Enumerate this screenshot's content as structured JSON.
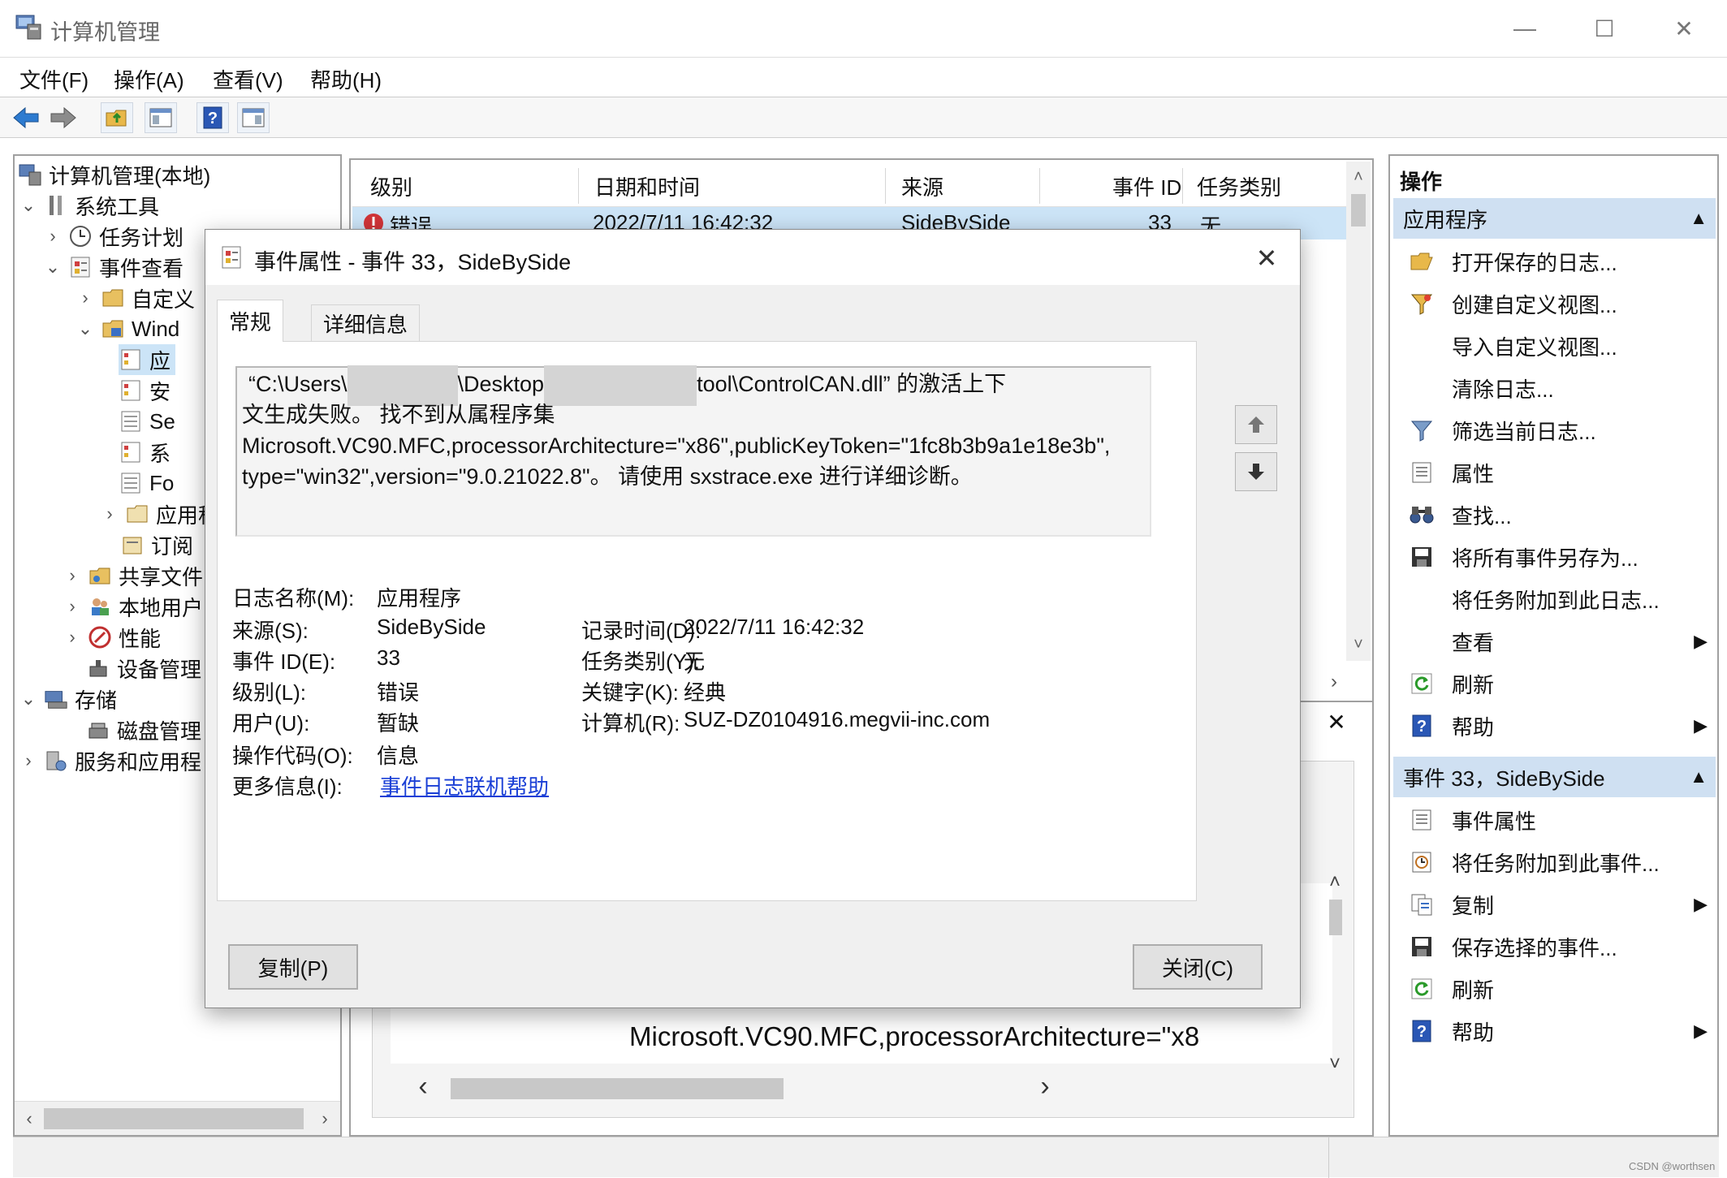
{
  "window": {
    "title": "计算机管理",
    "minimize_label": "—",
    "maximize_label": "☐",
    "close_label": "✕"
  },
  "menu": [
    "文件(F)",
    "操作(A)",
    "查看(V)",
    "帮助(H)"
  ],
  "tree": {
    "root": "计算机管理(本地)",
    "items": [
      {
        "label": "系统工具",
        "caret": "⌄"
      },
      {
        "label": "任务计划",
        "caret": "›"
      },
      {
        "label": "事件查看",
        "caret": "⌄"
      },
      {
        "label": "自定义",
        "caret": "›"
      },
      {
        "label": "Wind",
        "caret": "⌄"
      },
      {
        "label": "应",
        "caret": ""
      },
      {
        "label": "安",
        "caret": ""
      },
      {
        "label": "Se",
        "caret": ""
      },
      {
        "label": "系",
        "caret": ""
      },
      {
        "label": "Fo",
        "caret": ""
      },
      {
        "label": "应用程",
        "caret": "›"
      },
      {
        "label": "订阅",
        "caret": ""
      },
      {
        "label": "共享文件",
        "caret": "›"
      },
      {
        "label": "本地用户",
        "caret": "›"
      },
      {
        "label": "性能",
        "caret": "›"
      },
      {
        "label": "设备管理",
        "caret": ""
      },
      {
        "label": "存储",
        "caret": "⌄"
      },
      {
        "label": "磁盘管理",
        "caret": ""
      },
      {
        "label": "服务和应用程",
        "caret": "›"
      }
    ]
  },
  "event_table": {
    "columns": [
      "级别",
      "日期和时间",
      "来源",
      "事件 ID",
      "任务类别"
    ],
    "rows": [
      {
        "level": "错误",
        "datetime": "2022/7/11 16:42:32",
        "source": "SideBySide",
        "event_id": "33",
        "task": "无"
      }
    ]
  },
  "detail_preview_text": "Microsoft.VC90.MFC,processorArchitecture=\"x8",
  "actions": {
    "header": "操作",
    "groups": [
      {
        "title": "应用程序",
        "items": [
          {
            "label": "打开保存的日志...",
            "icon": "folder-open-icon",
            "submenu": false
          },
          {
            "label": "创建自定义视图...",
            "icon": "filter-icon",
            "submenu": false
          },
          {
            "label": "导入自定义视图...",
            "icon": "",
            "submenu": false
          },
          {
            "label": "清除日志...",
            "icon": "",
            "submenu": false
          },
          {
            "label": "筛选当前日志...",
            "icon": "filter-icon",
            "submenu": false
          },
          {
            "label": "属性",
            "icon": "properties-icon",
            "submenu": false
          },
          {
            "label": "查找...",
            "icon": "binoculars-icon",
            "submenu": false
          },
          {
            "label": "将所有事件另存为...",
            "icon": "save-icon",
            "submenu": false
          },
          {
            "label": "将任务附加到此日志...",
            "icon": "",
            "submenu": false
          },
          {
            "label": "查看",
            "icon": "",
            "submenu": true
          },
          {
            "label": "刷新",
            "icon": "refresh-icon",
            "submenu": false
          },
          {
            "label": "帮助",
            "icon": "help-icon",
            "submenu": true
          }
        ]
      },
      {
        "title": "事件 33，SideBySide",
        "items": [
          {
            "label": "事件属性",
            "icon": "properties-icon",
            "submenu": false
          },
          {
            "label": "将任务附加到此事件...",
            "icon": "task-icon",
            "submenu": false
          },
          {
            "label": "复制",
            "icon": "copy-icon",
            "submenu": true
          },
          {
            "label": "保存选择的事件...",
            "icon": "save-icon",
            "submenu": false
          },
          {
            "label": "刷新",
            "icon": "refresh-icon",
            "submenu": false
          },
          {
            "label": "帮助",
            "icon": "help-icon",
            "submenu": true
          }
        ]
      }
    ]
  },
  "dialog": {
    "title": "事件属性 - 事件 33，SideBySide",
    "tabs": [
      "常规",
      "详细信息"
    ],
    "message": {
      "line1_a": "“C:\\Users\\",
      "line1_b": "\\Desktop",
      "line1_c": "tool\\ControlCAN.dll” 的激活上下",
      "line2": "文生成失败。 找不到从属程序集",
      "line3": "Microsoft.VC90.MFC,processorArchitecture=\"x86\",publicKeyToken=\"1fc8b3b9a1e18e3b\",",
      "line4": "type=\"win32\",version=\"9.0.21022.8\"。 请使用 sxstrace.exe 进行详细诊断。"
    },
    "fields": {
      "log_name_label": "日志名称(M):",
      "log_name": "应用程序",
      "source_label": "来源(S):",
      "source": "SideBySide",
      "logged_label": "记录时间(D):",
      "logged": "2022/7/11 16:42:32",
      "event_id_label": "事件 ID(E):",
      "event_id": "33",
      "task_label": "任务类别(Y):",
      "task": "无",
      "level_label": "级别(L):",
      "level": "错误",
      "keywords_label": "关键字(K):",
      "keywords": "经典",
      "user_label": "用户(U):",
      "user": "暂缺",
      "computer_label": "计算机(R):",
      "computer": "SUZ-DZ0104916.megvii-inc.com",
      "opcode_label": "操作代码(O):",
      "opcode": "信息",
      "more_info_label": "更多信息(I):",
      "more_info_link": "事件日志联机帮助"
    },
    "copy_button": "复制(P)",
    "close_button": "关闭(C)"
  },
  "watermark": "CSDN @worthsen"
}
